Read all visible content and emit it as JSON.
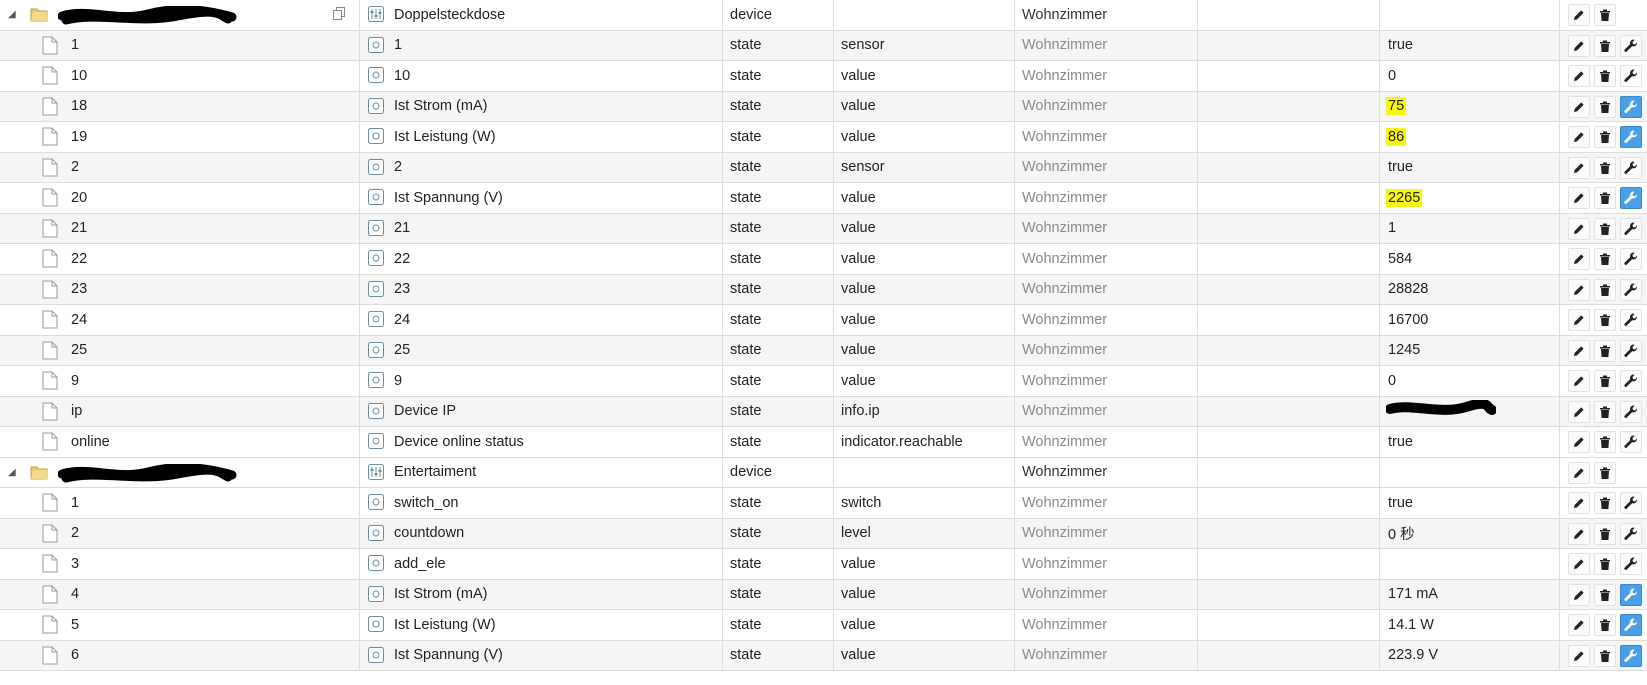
{
  "colors": {
    "highlight": "#f7f711",
    "wrench_active": "#4a9fe8",
    "room_text": "#8a8a8a"
  },
  "icons": {
    "tree_toggle": "triangle-down-icon",
    "folder": "folder-icon",
    "file": "file-icon",
    "device": "device-icon",
    "state": "state-icon",
    "copy": "copy-icon",
    "edit": "pencil-icon",
    "delete": "trash-icon",
    "config": "wrench-icon"
  },
  "rows": [
    {
      "kind": "device",
      "id": "",
      "name": "Doppelsteckdose",
      "type": "device",
      "role": "",
      "room": "Wohnzimmer",
      "value": "",
      "highlight": false,
      "wrench": false,
      "redacted_id": true,
      "copy": true
    },
    {
      "kind": "state",
      "id": "1",
      "name": "1",
      "type": "state",
      "role": "sensor",
      "room": "Wohnzimmer",
      "value": "true",
      "highlight": false,
      "wrench": false
    },
    {
      "kind": "state",
      "id": "10",
      "name": "10",
      "type": "state",
      "role": "value",
      "room": "Wohnzimmer",
      "value": "0",
      "highlight": false,
      "wrench": false
    },
    {
      "kind": "state",
      "id": "18",
      "name": "Ist Strom (mA)",
      "type": "state",
      "role": "value",
      "room": "Wohnzimmer",
      "value": "75",
      "highlight": true,
      "wrench": true
    },
    {
      "kind": "state",
      "id": "19",
      "name": "Ist Leistung (W)",
      "type": "state",
      "role": "value",
      "room": "Wohnzimmer",
      "value": "86",
      "highlight": true,
      "wrench": true
    },
    {
      "kind": "state",
      "id": "2",
      "name": "2",
      "type": "state",
      "role": "sensor",
      "room": "Wohnzimmer",
      "value": "true",
      "highlight": false,
      "wrench": false
    },
    {
      "kind": "state",
      "id": "20",
      "name": "Ist Spannung (V)",
      "type": "state",
      "role": "value",
      "room": "Wohnzimmer",
      "value": "2265",
      "highlight": true,
      "wrench": true
    },
    {
      "kind": "state",
      "id": "21",
      "name": "21",
      "type": "state",
      "role": "value",
      "room": "Wohnzimmer",
      "value": "1",
      "highlight": false,
      "wrench": false
    },
    {
      "kind": "state",
      "id": "22",
      "name": "22",
      "type": "state",
      "role": "value",
      "room": "Wohnzimmer",
      "value": "584",
      "highlight": false,
      "wrench": false
    },
    {
      "kind": "state",
      "id": "23",
      "name": "23",
      "type": "state",
      "role": "value",
      "room": "Wohnzimmer",
      "value": "28828",
      "highlight": false,
      "wrench": false
    },
    {
      "kind": "state",
      "id": "24",
      "name": "24",
      "type": "state",
      "role": "value",
      "room": "Wohnzimmer",
      "value": "16700",
      "highlight": false,
      "wrench": false
    },
    {
      "kind": "state",
      "id": "25",
      "name": "25",
      "type": "state",
      "role": "value",
      "room": "Wohnzimmer",
      "value": "1245",
      "highlight": false,
      "wrench": false
    },
    {
      "kind": "state",
      "id": "9",
      "name": "9",
      "type": "state",
      "role": "value",
      "room": "Wohnzimmer",
      "value": "0",
      "highlight": false,
      "wrench": false
    },
    {
      "kind": "state",
      "id": "ip",
      "name": "Device IP",
      "type": "state",
      "role": "info.ip",
      "room": "Wohnzimmer",
      "value": "",
      "highlight": false,
      "wrench": false,
      "redacted_value": true
    },
    {
      "kind": "state",
      "id": "online",
      "name": "Device online status",
      "type": "state",
      "role": "indicator.reachable",
      "room": "Wohnzimmer",
      "value": "true",
      "highlight": false,
      "wrench": false
    },
    {
      "kind": "device",
      "id": "",
      "name": "Entertaiment",
      "type": "device",
      "role": "",
      "room": "Wohnzimmer",
      "value": "",
      "highlight": false,
      "wrench": false,
      "redacted_id": true,
      "copy": false
    },
    {
      "kind": "state",
      "id": "1",
      "name": "switch_on",
      "type": "state",
      "role": "switch",
      "room": "Wohnzimmer",
      "value": "true",
      "highlight": false,
      "wrench": false
    },
    {
      "kind": "state",
      "id": "2",
      "name": "countdown",
      "type": "state",
      "role": "level",
      "room": "Wohnzimmer",
      "value": "0 秒",
      "highlight": false,
      "wrench": false
    },
    {
      "kind": "state",
      "id": "3",
      "name": "add_ele",
      "type": "state",
      "role": "value",
      "room": "Wohnzimmer",
      "value": "",
      "highlight": false,
      "wrench": false
    },
    {
      "kind": "state",
      "id": "4",
      "name": "Ist Strom (mA)",
      "type": "state",
      "role": "value",
      "room": "Wohnzimmer",
      "value": "171 mA",
      "highlight": false,
      "wrench": true
    },
    {
      "kind": "state",
      "id": "5",
      "name": "Ist Leistung (W)",
      "type": "state",
      "role": "value",
      "room": "Wohnzimmer",
      "value": "14.1 W",
      "highlight": false,
      "wrench": true
    },
    {
      "kind": "state",
      "id": "6",
      "name": "Ist Spannung (V)",
      "type": "state",
      "role": "value",
      "room": "Wohnzimmer",
      "value": "223.9 V",
      "highlight": false,
      "wrench": true
    }
  ]
}
